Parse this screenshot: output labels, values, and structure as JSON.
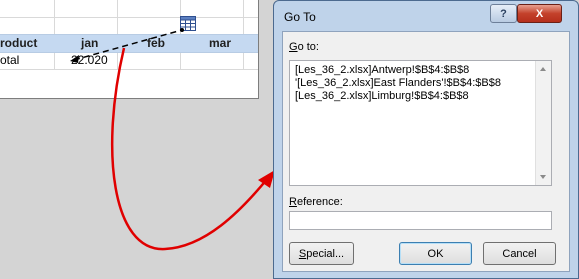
{
  "spreadsheet": {
    "headers": [
      "roduct",
      "jan",
      "feb",
      "mar"
    ],
    "row_label": "otal",
    "jan_value": "22.020"
  },
  "dialog": {
    "title": "Go To",
    "help_button": "?",
    "close_button": "X",
    "goto_label_pre": "G",
    "goto_label_rest": "o to:",
    "list_items": [
      "[Les_36_2.xlsx]Antwerp!$B$4:$B$8",
      "'[Les_36_2.xlsx]East Flanders'!$B$4:$B$8",
      "[Les_36_2.xlsx]Limburg!$B$4:$B$8"
    ],
    "reference_label_pre": "R",
    "reference_label_rest": "eference:",
    "reference_value": "",
    "special_button_pre": "S",
    "special_button_rest": "pecial...",
    "ok_button": "OK",
    "cancel_button": "Cancel"
  },
  "colors": {
    "header_fill": "#c5d9f1",
    "annotation_arrow": "#e00000",
    "dialog_frame": "#bfd3ea",
    "close_button": "#c4412b"
  },
  "icons": {
    "trace_precedent": "worksheet-grid-icon",
    "scroll_up": "scroll-up-icon",
    "scroll_down": "scroll-down-icon"
  }
}
